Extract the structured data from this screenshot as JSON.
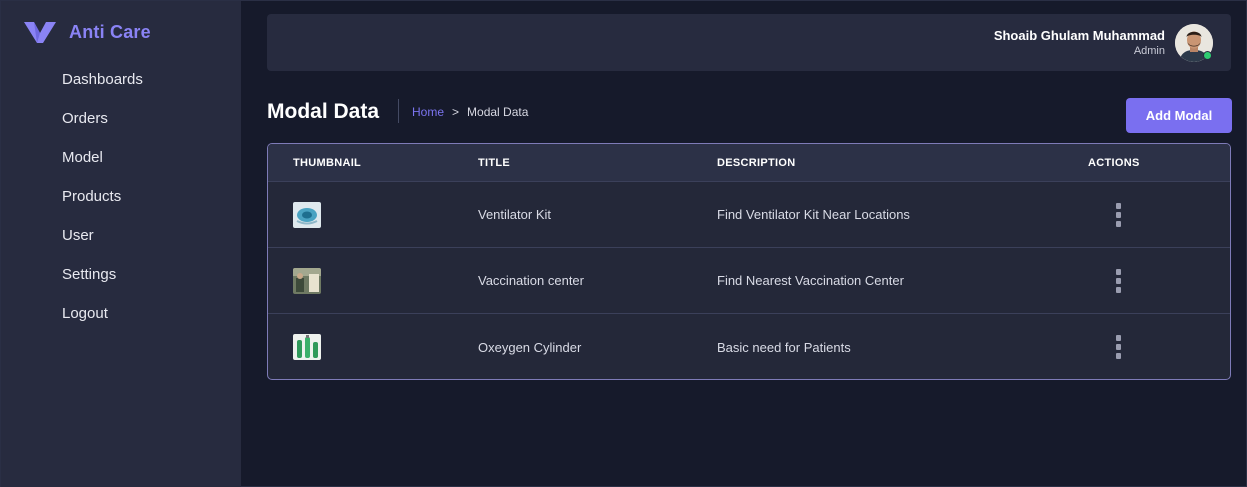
{
  "app": {
    "brand_name": "Anti Care",
    "colors": {
      "accent": "#7a6ff0",
      "sidebar_bg": "#272b3f",
      "page_bg": "#161a2b",
      "online": "#2ecc71"
    }
  },
  "sidebar": {
    "items": [
      {
        "label": "Dashboards"
      },
      {
        "label": "Orders"
      },
      {
        "label": "Model"
      },
      {
        "label": "Products"
      },
      {
        "label": "User"
      },
      {
        "label": "Settings"
      },
      {
        "label": "Logout"
      }
    ]
  },
  "header": {
    "user_name": "Shoaib Ghulam Muhammad",
    "user_role": "Admin",
    "avatar_icon": "user-avatar"
  },
  "page": {
    "title": "Modal Data",
    "breadcrumb": {
      "home": "Home",
      "separator": ">",
      "current": "Modal Data"
    },
    "add_button_label": "Add Modal"
  },
  "table": {
    "columns": [
      "THUMBNAIL",
      "TITLE",
      "DESCRIPTION",
      "ACTIONS"
    ],
    "rows": [
      {
        "thumbnail_icon": "ventilator-kit-thumbnail",
        "title": "Ventilator Kit",
        "description": "Find Ventilator Kit Near Locations",
        "actions_icon": "kebab-menu-icon"
      },
      {
        "thumbnail_icon": "vaccination-center-thumbnail",
        "title": "Vaccination center",
        "description": "Find Nearest Vaccination Center",
        "actions_icon": "kebab-menu-icon"
      },
      {
        "thumbnail_icon": "oxygen-cylinder-thumbnail",
        "title": "Oxeygen Cylinder",
        "description": "Basic need for Patients",
        "actions_icon": "kebab-menu-icon"
      }
    ]
  }
}
